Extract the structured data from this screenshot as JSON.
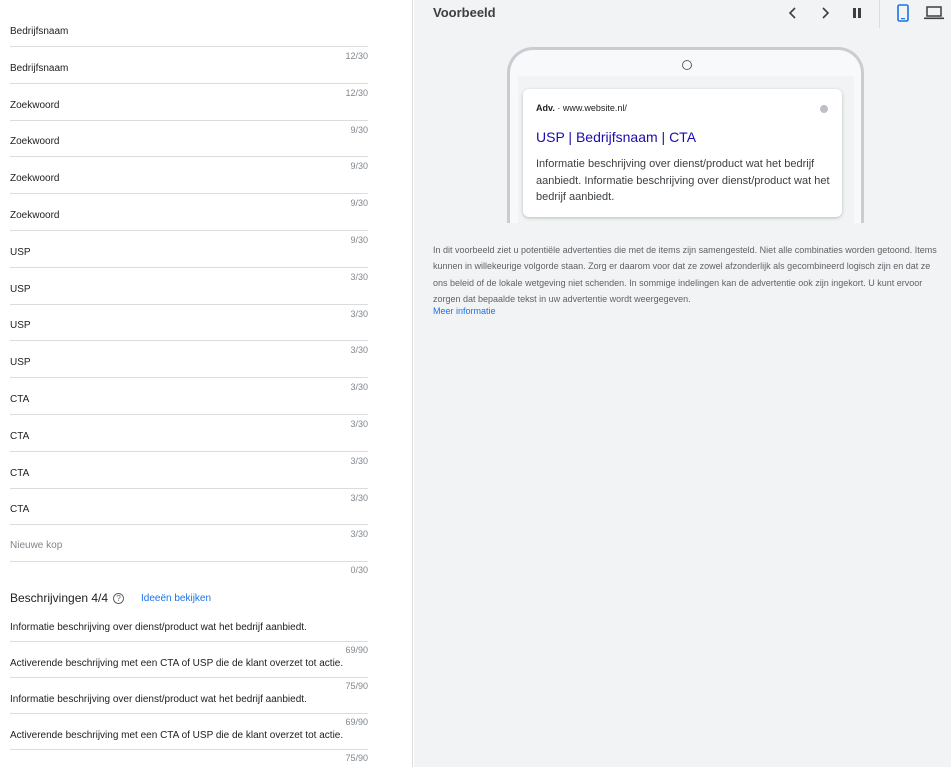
{
  "headlines": [
    {
      "value": "Bedrijfsnaam",
      "count": "12/30"
    },
    {
      "value": "Bedrijfsnaam",
      "count": "12/30"
    },
    {
      "value": "Zoekwoord",
      "count": "9/30"
    },
    {
      "value": "Zoekwoord",
      "count": "9/30"
    },
    {
      "value": "Zoekwoord",
      "count": "9/30"
    },
    {
      "value": "Zoekwoord",
      "count": "9/30"
    },
    {
      "value": "USP",
      "count": "3/30"
    },
    {
      "value": "USP",
      "count": "3/30"
    },
    {
      "value": "USP",
      "count": "3/30"
    },
    {
      "value": "USP",
      "count": "3/30"
    },
    {
      "value": "CTA",
      "count": "3/30"
    },
    {
      "value": "CTA",
      "count": "3/30"
    },
    {
      "value": "CTA",
      "count": "3/30"
    },
    {
      "value": "CTA",
      "count": "3/30"
    }
  ],
  "new_headline": {
    "placeholder": "Nieuwe kop",
    "count": "0/30"
  },
  "descriptions_section": {
    "title": "Beschrijvingen 4/4",
    "help_icon": "help-circle-icon",
    "ideas_link": "Ideeën bekijken"
  },
  "descriptions": [
    {
      "value": "Informatie beschrijving over dienst/product wat het bedrijf aanbiedt.",
      "count": "69/90"
    },
    {
      "value": "Activerende beschrijving met een CTA of USP die de klant overzet tot actie.",
      "count": "75/90"
    },
    {
      "value": "Informatie beschrijving over dienst/product wat het bedrijf aanbiedt.",
      "count": "69/90"
    },
    {
      "value": "Activerende beschrijving met een CTA of USP die de klant overzet tot actie.",
      "count": "75/90"
    }
  ],
  "preview": {
    "title": "Voorbeeld",
    "toolbar_icons": [
      "chevron-left-icon",
      "chevron-right-icon",
      "pause-icon",
      "mobile-icon",
      "laptop-icon"
    ],
    "active_device": "mobile",
    "ad": {
      "label": "Adv.",
      "url": "· www.website.nl/",
      "headline": "USP | Bedrijfsnaam | CTA",
      "description": "Informatie beschrijving over dienst/product wat het bedrijf aanbiedt. Informatie beschrijving over dienst/product wat het bedrijf aanbiedt."
    },
    "info_text": "In dit voorbeeld ziet u potentiële advertenties die met de items zijn samengesteld. Niet alle combinaties worden getoond. Items kunnen in willekeurige volgorde staan. Zorg er daarom voor dat ze zowel afzonderlijk als gecombineerd logisch zijn en dat ze ons beleid of de lokale wetgeving niet schenden. In sommige indelingen kan de advertentie ook zijn ingekort. U kunt ervoor zorgen dat bepaalde tekst in uw advertentie wordt weergegeven.",
    "more_link": "Meer informatie"
  },
  "colors": {
    "link": "#1a73e8",
    "ad_headline": "#1a0dab",
    "active_icon": "#1a73e8",
    "panel_bg": "#f1f3f4"
  }
}
